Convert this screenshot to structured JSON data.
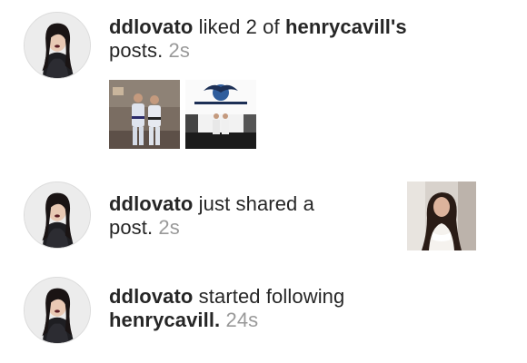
{
  "activities": [
    {
      "username": "ddlovato",
      "action": " liked 2 of ",
      "target": "henrycavill's",
      "action_end": " posts.",
      "time": " 2s",
      "avatar_icon": "profile-avatar-icon",
      "thumbnails": [
        "liked-post-thumbnail-martial-arts-duo",
        "liked-post-thumbnail-dojo-group"
      ]
    },
    {
      "username": "ddlovato",
      "action": " just shared a post.",
      "time": " 2s",
      "avatar_icon": "profile-avatar-icon",
      "post_thumbnail": "shared-post-thumbnail"
    },
    {
      "username": "ddlovato",
      "action": " started following ",
      "target": "henrycavill.",
      "time": " 24s",
      "avatar_icon": "profile-avatar-icon"
    }
  ],
  "colors": {
    "text": "#262626",
    "timestamp": "#999999",
    "background": "#ffffff"
  }
}
